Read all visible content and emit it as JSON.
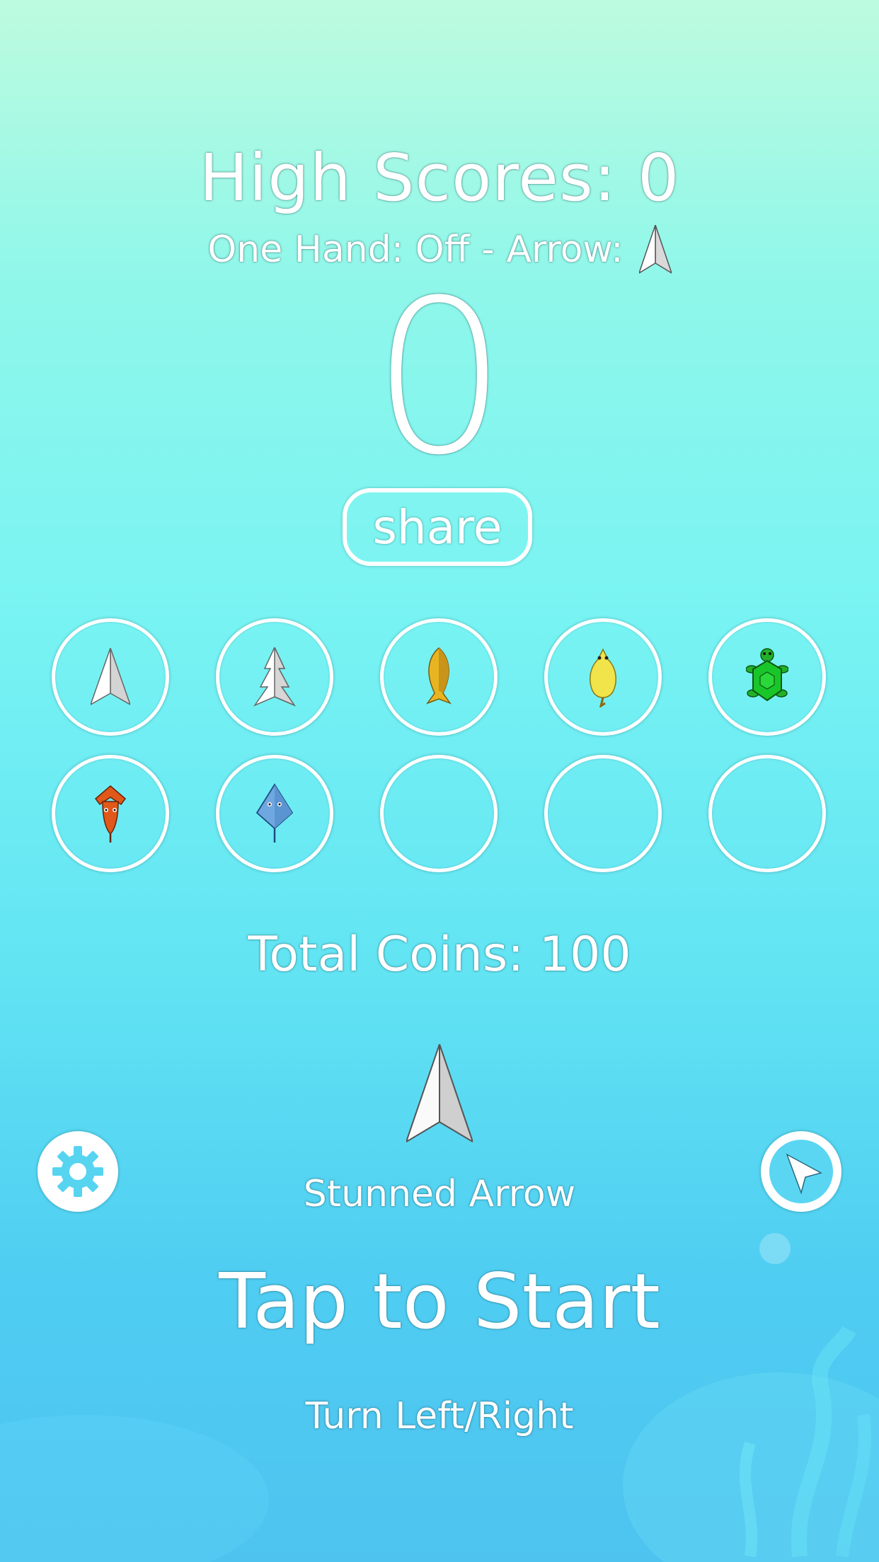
{
  "header": {
    "high_scores": "High Scores: 0",
    "subline": "One Hand: Off - Arrow:",
    "current_score": "0"
  },
  "share_label": "share",
  "characters": [
    {
      "name": "white-arrow-icon",
      "locked": false
    },
    {
      "name": "pine-arrow-icon",
      "locked": false
    },
    {
      "name": "gold-fish-icon",
      "locked": false
    },
    {
      "name": "yellow-chick-icon",
      "locked": false
    },
    {
      "name": "green-turtle-icon",
      "locked": false
    },
    {
      "name": "orange-squid-icon",
      "locked": false
    },
    {
      "name": "blue-stingray-icon",
      "locked": false
    },
    {
      "name": "empty-slot",
      "locked": true
    },
    {
      "name": "empty-slot",
      "locked": true
    },
    {
      "name": "empty-slot",
      "locked": true
    }
  ],
  "total_coins": "Total Coins: 100",
  "selected_character": "Stunned Arrow",
  "tap_to_start": "Tap to Start",
  "controls_hint": "Turn Left/Right",
  "icons": {
    "settings": "gear-icon",
    "pointer": "pointer-icon"
  },
  "colors": {
    "text": "#ffffff",
    "background_top": "#bdfbdf",
    "background_bottom": "#4ec3f0"
  }
}
